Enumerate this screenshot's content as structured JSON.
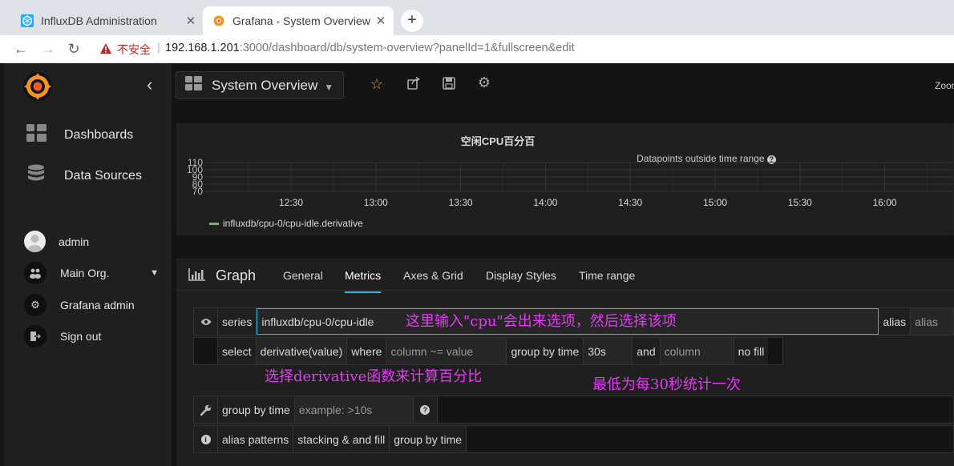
{
  "browser": {
    "tabs": [
      {
        "title": "InfluxDB Administration",
        "icon": "influxdb-icon"
      },
      {
        "title": "Grafana - System Overview",
        "icon": "grafana-icon"
      }
    ],
    "new_tab": "+",
    "security_label": "不安全",
    "url_host": "192.168.1.201",
    "url_rest": ":3000/dashboard/db/system-overview?panelId=1&fullscreen&edit"
  },
  "sidebar": {
    "items": [
      {
        "label": "Dashboards",
        "icon": "dashboards-icon"
      },
      {
        "label": "Data Sources",
        "icon": "database-icon"
      }
    ],
    "user": "admin",
    "org": "Main Org.",
    "grafana_admin": "Grafana admin",
    "sign_out": "Sign out"
  },
  "topnav": {
    "dashboard_title": "System Overview",
    "zoom": "Zoom"
  },
  "chart_data": {
    "type": "line",
    "title": "空闲CPU百分百",
    "subtitle": "Datapoints outside time range",
    "yticks": [
      110,
      100,
      90,
      80,
      70
    ],
    "ylim": [
      70,
      110
    ],
    "xticks": [
      "12:30",
      "13:00",
      "13:30",
      "14:00",
      "14:30",
      "15:00",
      "15:30",
      "16:00"
    ],
    "grid": true,
    "legend_placement": "bottom-left",
    "series": [
      {
        "name": "influxdb/cpu-0/cpu-idle.derivative",
        "color": "#7eb26d",
        "values": []
      }
    ]
  },
  "editor": {
    "title": "Graph",
    "tabs": [
      "General",
      "Metrics",
      "Axes & Grid",
      "Display Styles",
      "Time range"
    ],
    "active_tab": "Metrics",
    "series_label": "series",
    "series_value": "influxdb/cpu-0/cpu-idle",
    "alias_label": "alias",
    "alias_placeholder": "alias",
    "select_label": "select",
    "select_value": "derivative(value)",
    "where_label": "where",
    "where_placeholder": "column ~= value",
    "group_by_time_label": "group by time",
    "group_by_time_value": "30s",
    "and_label": "and",
    "column_placeholder": "column",
    "fill_label": "no fill",
    "group_by_time_label2": "group by time",
    "group_by_time_placeholder": "example: >10s",
    "alias_patterns": "alias patterns",
    "stacking": "stacking & and fill",
    "group_by_time_label3": "group by time"
  },
  "annotations": {
    "series_note": "这里输入\"cpu\"会出来选项，然后选择该项",
    "select_note": "选择derivative函数来计算百分比",
    "time_note": "最低为每30秒统计一次"
  }
}
